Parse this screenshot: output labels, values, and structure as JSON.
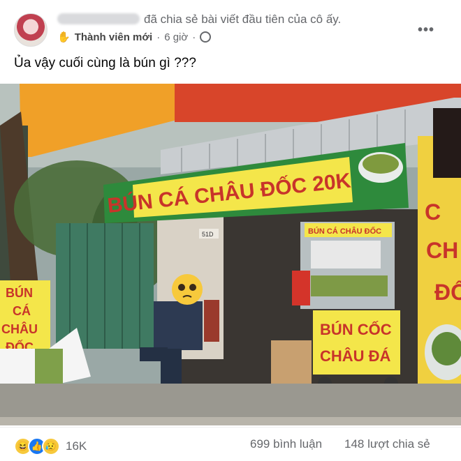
{
  "post": {
    "author_suffix": "đã chia sẻ bài viết đầu tiên của cô ấy.",
    "badge": "Thành viên mới",
    "separator": "·",
    "time": "6 giờ",
    "separator2": "·",
    "more": "•••",
    "text": "Ủa vậy cuối cùng là bún gì ???"
  },
  "photo": {
    "sign_main": "BÚN CÁ CHÂU ĐỐC 20K",
    "sign_cart_top": "BÚN CÁ CHÂU ĐỐC",
    "sign_cart_line1": "BÚN CỐC",
    "sign_cart_line2": "CHÂU ĐÁ",
    "sign_left_1": "BÚN",
    "sign_left_2": "CÁ",
    "sign_left_3": "CHÂU",
    "sign_left_4": "ĐỐC",
    "sign_right_1": "C",
    "sign_right_2": "CH",
    "sign_right_3": "ĐỐ",
    "small_number": "51D"
  },
  "footer": {
    "reaction_count": "16K",
    "comments": "699 bình luận",
    "shares": "148 lượt chia sẻ",
    "reaction_icons": [
      "haha-icon",
      "like-icon",
      "sad-icon"
    ]
  },
  "colors": {
    "banner_green": "#2e8a3c",
    "banner_yellow": "#f4e64a",
    "sign_red": "#c8342a",
    "awning": "#f0a028"
  }
}
